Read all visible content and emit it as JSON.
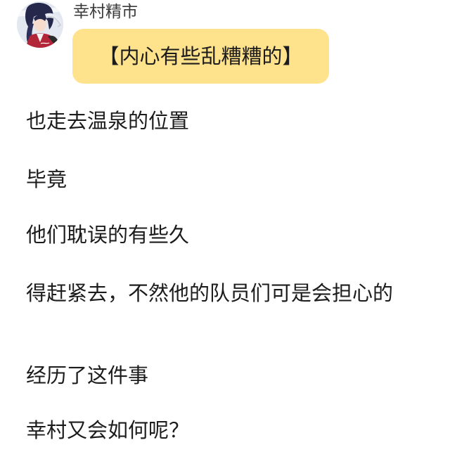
{
  "message": {
    "username": "幸村精市",
    "bubble_text": "【内心有些乱糟糟的】"
  },
  "story": {
    "lines": [
      "也走去温泉的位置",
      "毕竟",
      "他们耽误的有些久",
      "得赶紧去，不然他的队员们可是会担心的",
      "经历了这件事",
      "幸村又会如何呢？"
    ]
  }
}
